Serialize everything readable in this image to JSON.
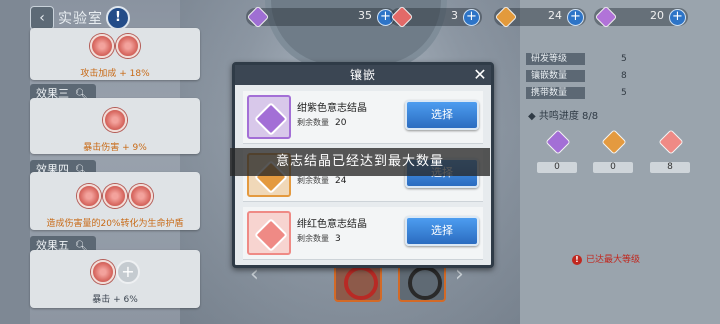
{
  "header": {
    "title": "实验室",
    "back_icon": "‹",
    "help_label": "!"
  },
  "resources": [
    {
      "name": "purple-crystal",
      "value": "35",
      "color": "#9f6fd3"
    },
    {
      "name": "red-crystal",
      "value": "3",
      "color": "#e36a68"
    },
    {
      "name": "orange-crystal",
      "value": "24",
      "color": "#e39a3c"
    },
    {
      "name": "violet-crystal",
      "value": "20",
      "color": "#b173d8"
    }
  ],
  "effects": {
    "top_text": "攻击加成 + 18%",
    "effect3": {
      "title": "效果三",
      "text": "暴击伤害 + 9%"
    },
    "effect4": {
      "title": "效果四",
      "text": "造成伤害量的20%转化为生命护盾"
    },
    "effect5": {
      "title": "效果五",
      "text": "暴击 + 6%"
    }
  },
  "info": {
    "rows": [
      {
        "label": "研发等级",
        "value": "5"
      },
      {
        "label": "镶嵌数量",
        "value": "8"
      },
      {
        "label": "携带数量",
        "value": "5"
      }
    ],
    "resonance_label": "共鸣进度 8/8",
    "resonance_values": [
      "0",
      "0",
      "8"
    ],
    "max_level": "已达最大等级"
  },
  "modal": {
    "title": "镶嵌",
    "close": "✕",
    "count_label": "剩余数量",
    "select_label": "选择",
    "crystals": [
      {
        "name": "绀紫色意志结晶",
        "count": "20",
        "color": "#a36fd6"
      },
      {
        "name": "",
        "count": "24",
        "color": "#e49a3f"
      },
      {
        "name": "绯红色意志结晶",
        "count": "3",
        "color": "#ef8a85"
      }
    ]
  },
  "toast": "意志结晶已经达到最大数量"
}
